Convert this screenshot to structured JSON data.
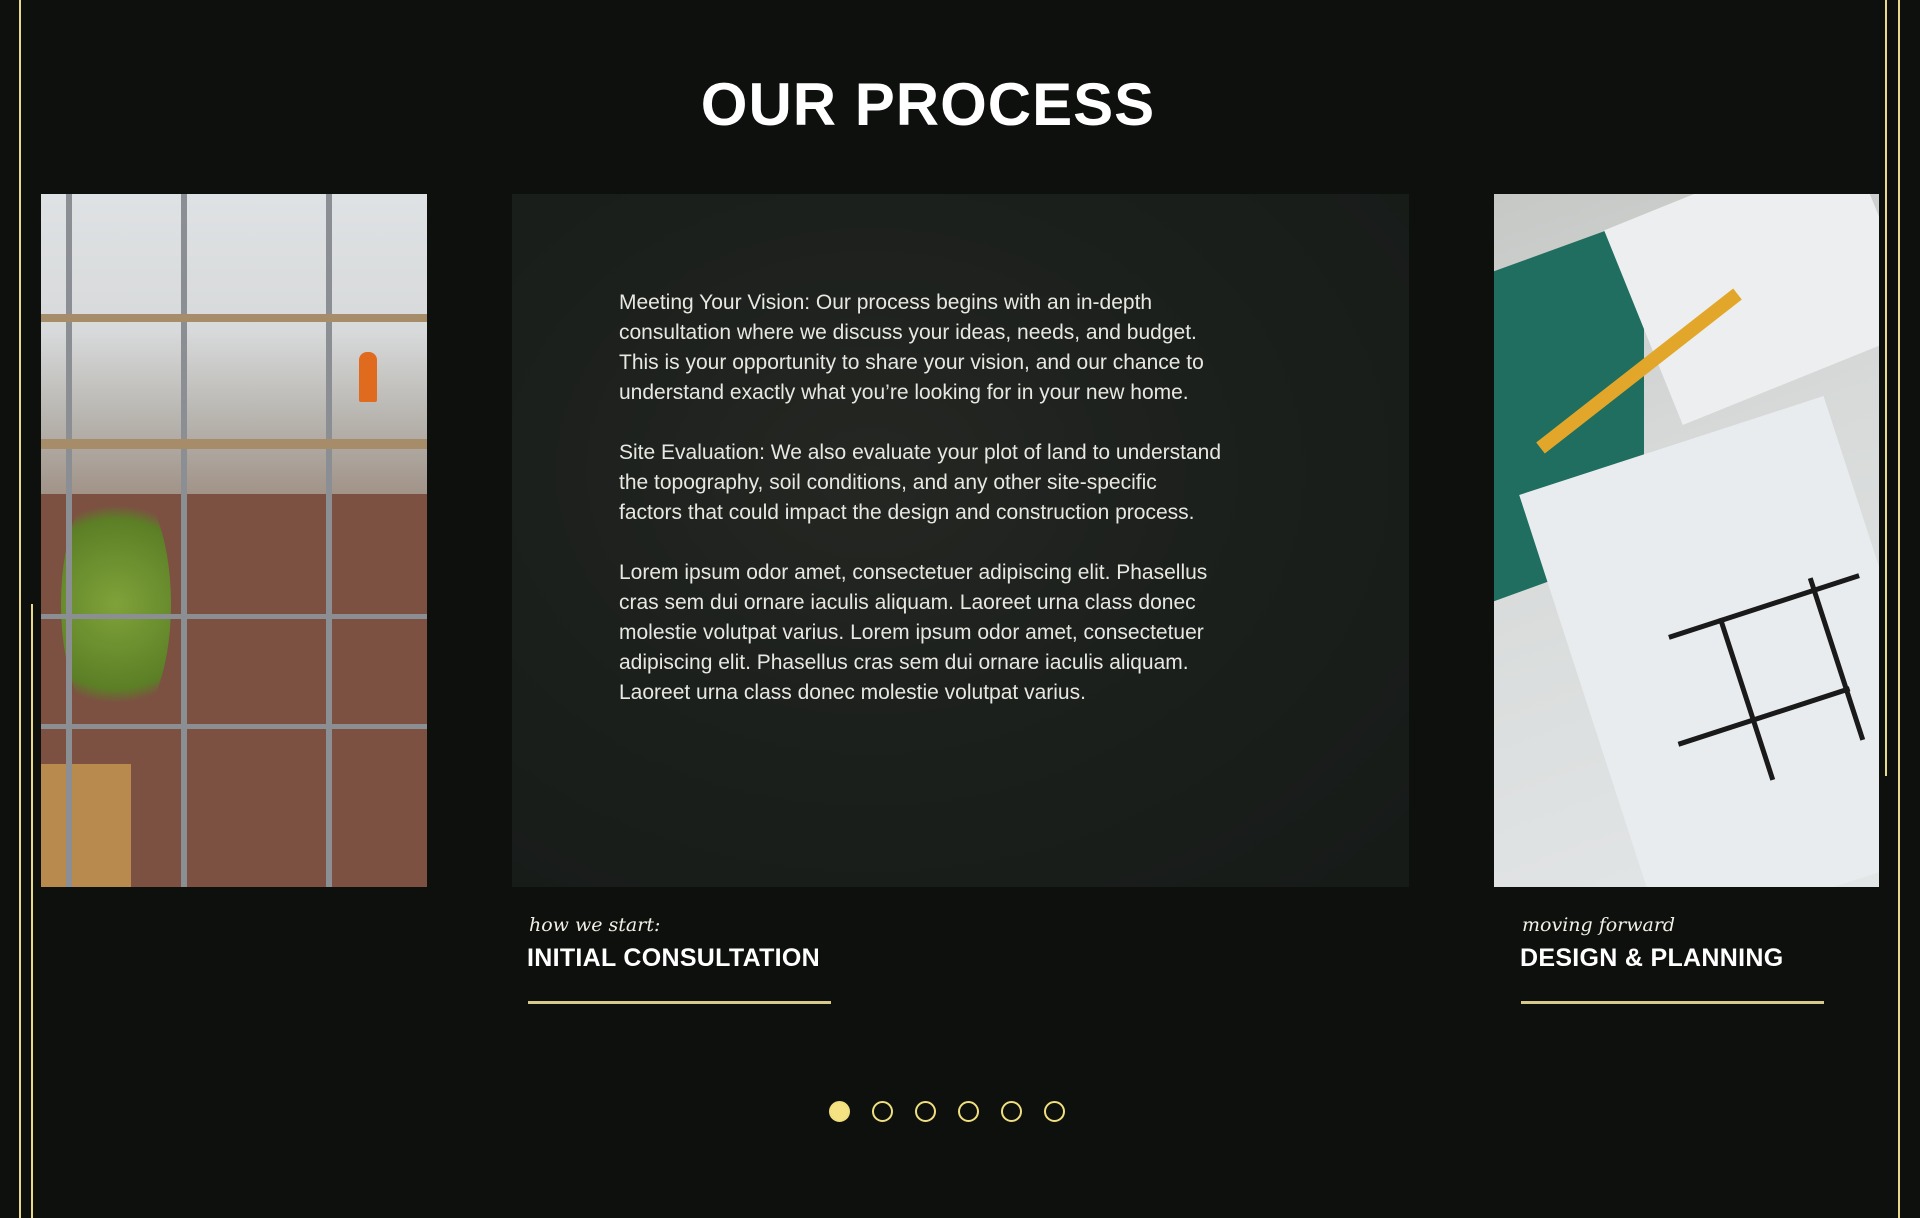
{
  "section": {
    "title": "OUR PROCESS"
  },
  "slides": {
    "current": {
      "paragraphs": [
        "Meeting Your Vision: Our process begins with an in-depth consultation where we discuss your ideas, needs, and budget. This is your opportunity to share your vision, and our chance to understand exactly what you’re looking for in your new home.",
        "Site Evaluation: We also evaluate your plot of land to understand the topography, soil conditions, and any other site-specific factors that could impact the design and construction process.",
        "Lorem ipsum odor amet, consectetuer adipiscing elit. Phasellus cras sem dui ornare iaculis aliquam. Laoreet urna class donec molestie volutpat varius. Lorem ipsum odor amet, consectetuer adipiscing elit. Phasellus cras sem dui ornare iaculis aliquam. Laoreet urna class donec molestie volutpat varius."
      ],
      "subtitle": "how we start:",
      "heading": "INITIAL CONSULTATION"
    },
    "next": {
      "subtitle": "moving forward",
      "heading": "DESIGN & PLANNING"
    }
  },
  "pagination": {
    "count": 6,
    "active_index": 0
  },
  "colors": {
    "background": "#0d100c",
    "accent": "#f5e383",
    "rule": "#d7c989"
  }
}
